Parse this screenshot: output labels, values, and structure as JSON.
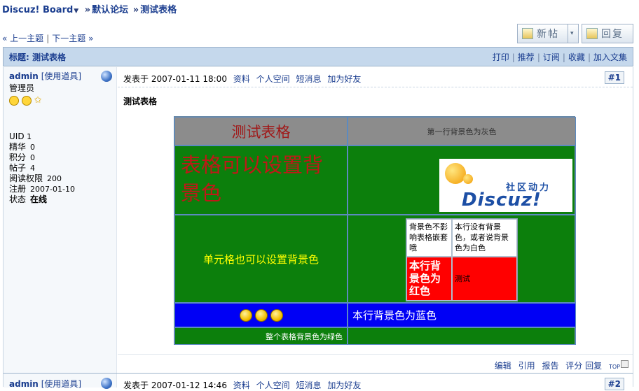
{
  "breadcrumb": {
    "forum_home": "Discuz! Board",
    "separator": "»",
    "forum": "默认论坛",
    "thread": "测试表格"
  },
  "thread_nav": {
    "prev_glyph": "«",
    "prev": "上一主题",
    "divider": "|",
    "next": "下一主题",
    "next_glyph": "»"
  },
  "toolbar": {
    "new_post": "新帖",
    "reply": "回复",
    "dropdown_glyph": "▾"
  },
  "title_bar": {
    "title": "标题: 测试表格",
    "actions": [
      "打印",
      "推荐",
      "订阅",
      "收藏",
      "加入文集"
    ]
  },
  "post1": {
    "author": "admin",
    "props_link": "[使用道具]",
    "role": "管理员",
    "stats": [
      {
        "label": "UID",
        "value": "1"
      },
      {
        "label": "精华",
        "value": "0"
      },
      {
        "label": "积分",
        "value": "0"
      },
      {
        "label": "帖子",
        "value": "4"
      },
      {
        "label": "阅读权限",
        "value": "200"
      },
      {
        "label": "注册",
        "value": "2007-01-10"
      }
    ],
    "status_label": "状态",
    "status_value": "在线",
    "posted_at": "发表于 2007-01-11 18:00",
    "meta_links": [
      "资料",
      "个人空间",
      "短消息",
      "加为好友"
    ],
    "floor": "#1",
    "title": "测试表格",
    "table": {
      "r1c1": "测试表格",
      "r1c2": "第一行背景色为灰色",
      "r2c1": "表格可以设置背景色",
      "logo_cn": "社区动力",
      "logo_word": "Discuz!",
      "r3c1": "单元格也可以设置背景色",
      "nested": {
        "n11": "背景色不影响表格嵌套哦",
        "n12": "本行没有背景色，或者说背景色为白色",
        "n21": "本行背景色为红色",
        "n22": "测试"
      },
      "r4c2": "本行背景色为蓝色",
      "r5c1": "整个表格背景色为绿色"
    },
    "footer_actions": [
      "编辑",
      "引用",
      "报告",
      "评分",
      "回复"
    ],
    "top_label": "TOP"
  },
  "post2": {
    "author": "admin",
    "props_link": "[使用道具]",
    "posted_at": "发表于 2007-01-12 14:46",
    "meta_links": [
      "资料",
      "个人空间",
      "短消息",
      "加为好友"
    ],
    "floor": "#2"
  },
  "icons": [
    "chevron-down-icon",
    "new-post-icon",
    "reply-icon",
    "online-globe-icon",
    "smile-icon",
    "star-icon",
    "emoticon-icon",
    "top-icon"
  ],
  "colors": {
    "accent": "#1a3d8f",
    "table_green": "#0c7f0c",
    "row_gray": "#8c8c8c",
    "row_blue": "#0000f5",
    "cell_red": "#ff0000"
  }
}
